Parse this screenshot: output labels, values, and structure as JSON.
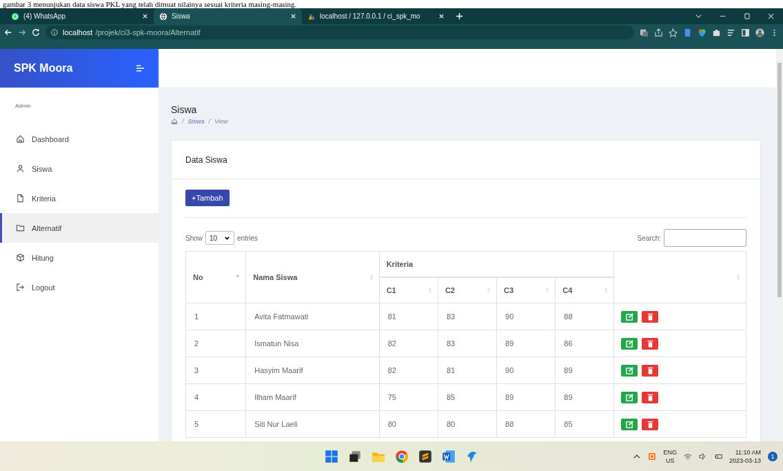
{
  "document_caption": "gambar 3 menunjukan data siswa PKL yang telah dimuat nilainya sesuai kriteria masing-masing.",
  "browser": {
    "tabs": [
      {
        "label": "(4) WhatsApp",
        "kind": "whatsapp",
        "selected": false
      },
      {
        "label": "Siswa",
        "kind": "globe",
        "selected": true
      },
      {
        "label": "localhost / 127.0.0.1 / ci_spk_mo",
        "kind": "db",
        "selected": false
      }
    ],
    "url_host": "localhost",
    "url_path": "/projek/ci3-spk-moora/Alternatif"
  },
  "sidebar": {
    "brand": "SPK Moora",
    "section": "Admin",
    "items": [
      {
        "label": "Dashboard",
        "kind": "home",
        "selected": false
      },
      {
        "label": "Siswa",
        "kind": "user",
        "selected": false
      },
      {
        "label": "Kriteria",
        "kind": "file",
        "selected": false
      },
      {
        "label": "Alternatif",
        "kind": "folder",
        "selected": true
      },
      {
        "label": "Hitung",
        "kind": "box",
        "selected": false
      },
      {
        "label": "Logout",
        "kind": "logout",
        "selected": false
      }
    ]
  },
  "page": {
    "title": "Siswa",
    "breadcrumb": [
      {
        "separator": "/",
        "label": "Siswa"
      },
      {
        "separator": "/",
        "label": "View"
      }
    ],
    "card_title": "Data Siswa",
    "add_button": "+Tambah",
    "show_label": "Show",
    "page_size": "10",
    "entries_label": "entries",
    "search_label": "Search:"
  },
  "table": {
    "columns": {
      "no": "No",
      "name": "Nama Siswa",
      "group": "Kriteria",
      "criteria": [
        "C1",
        "C2",
        "C3",
        "C4"
      ]
    },
    "rows": [
      {
        "no": "1",
        "name": "Avita Fatmawati",
        "values": [
          "81",
          "83",
          "90",
          "88"
        ]
      },
      {
        "no": "2",
        "name": "Ismatun Nisa",
        "values": [
          "82",
          "83",
          "89",
          "86"
        ]
      },
      {
        "no": "3",
        "name": "Hasyim Maarif",
        "values": [
          "82",
          "81",
          "90",
          "89"
        ]
      },
      {
        "no": "4",
        "name": "Ilham Maarif",
        "values": [
          "75",
          "85",
          "89",
          "89"
        ]
      },
      {
        "no": "5",
        "name": "Siti Nur Laeli",
        "values": [
          "80",
          "80",
          "88",
          "85"
        ]
      }
    ]
  },
  "taskbar": {
    "language": "ENG",
    "region": "US",
    "time": "11:10 AM",
    "date": "2023-03-13",
    "notifications": "1"
  }
}
